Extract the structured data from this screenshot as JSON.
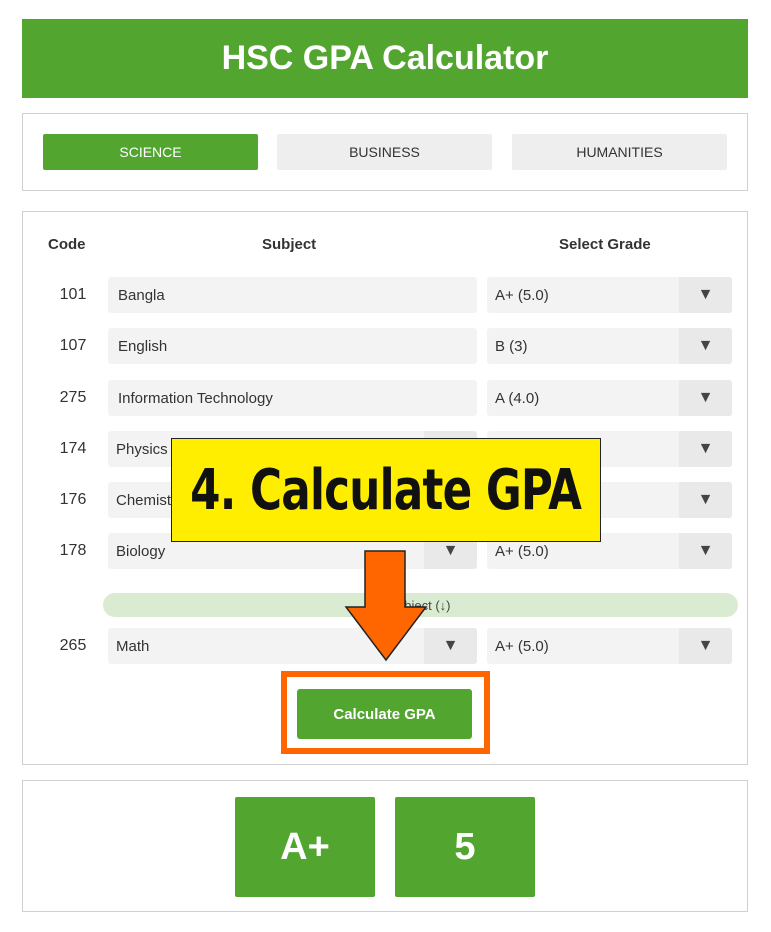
{
  "app": {
    "title": "HSC GPA Calculator"
  },
  "tabs": [
    {
      "label": "SCIENCE",
      "active": true
    },
    {
      "label": "BUSINESS",
      "active": false
    },
    {
      "label": "HUMANITIES",
      "active": false
    }
  ],
  "table": {
    "headers": {
      "code": "Code",
      "subject": "Subject",
      "grade": "Select Grade"
    },
    "rows": [
      {
        "code": "101",
        "subject": "Bangla",
        "grade": "A+ (5.0)"
      },
      {
        "code": "107",
        "subject": "English",
        "grade": "B (3)"
      },
      {
        "code": "275",
        "subject": "Information Technology",
        "grade": "A (4.0)"
      },
      {
        "code": "174",
        "subject": "Physics",
        "grade": ""
      },
      {
        "code": "176",
        "subject": "Chemist",
        "grade": ""
      },
      {
        "code": "178",
        "subject": "Biology",
        "grade": "A+ (5.0)"
      }
    ],
    "optional_label": "subject (↓)",
    "optional_row": {
      "code": "265",
      "subject": "Math",
      "grade": "A+ (5.0)"
    },
    "dropdown_glyph": "▼"
  },
  "actions": {
    "calculate_label": "Calculate GPA"
  },
  "annotation": {
    "callout_text": "4. Calculate GPA",
    "outline_color": "#ff6600",
    "callout_color": "#ffee00"
  },
  "result": {
    "grade": "A+",
    "gpa": "5"
  },
  "colors": {
    "brand": "#52a62f",
    "tab_inactive": "#eeeeee",
    "optional_bar": "#d9ecd2"
  }
}
